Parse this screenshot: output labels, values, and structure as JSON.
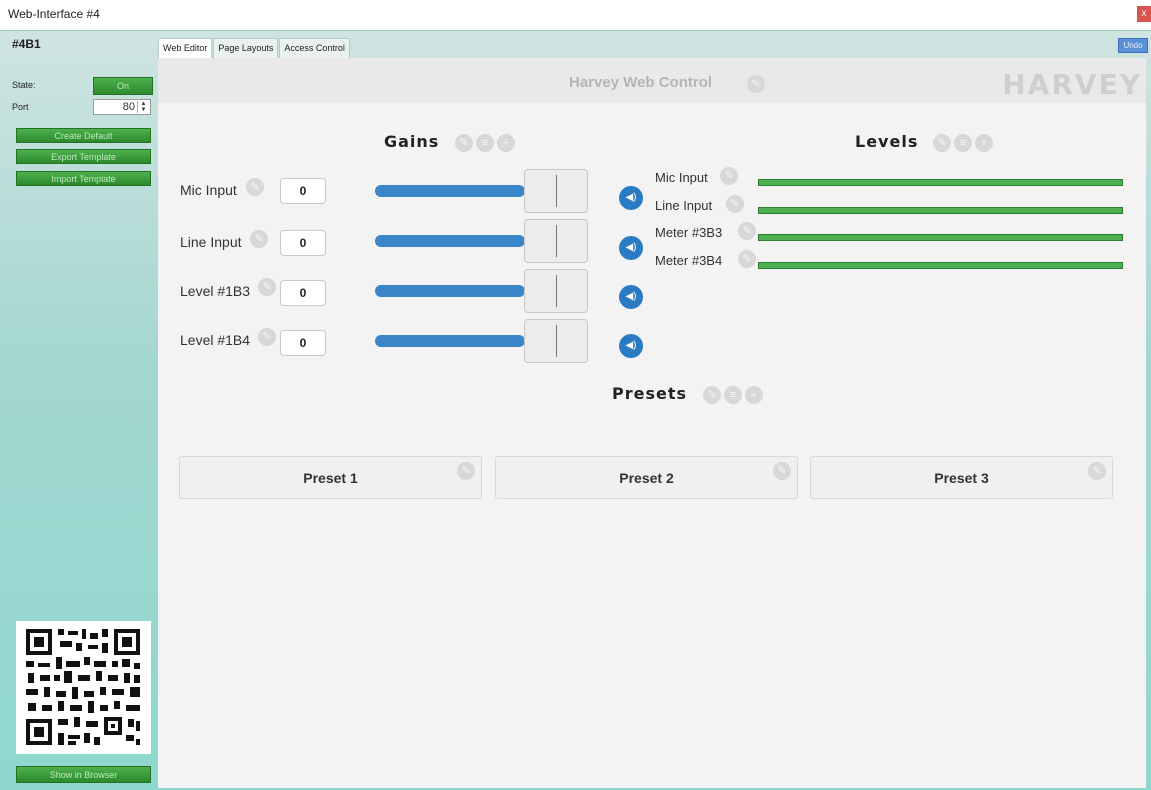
{
  "window": {
    "title": "Web-Interface #4",
    "close_label": "x"
  },
  "sidebar": {
    "node_id": "#4B1",
    "state_label": "State:",
    "state_value": "On",
    "port_label": "Port",
    "port_value": "80",
    "buttons": [
      "Create Default",
      "Export Template",
      "Import Template"
    ],
    "show_browser": "Show in Browser"
  },
  "tabs": [
    "Web Editor",
    "Page Layouts",
    "Access Control"
  ],
  "undo_label": "Undo",
  "header": {
    "title": "Harvey Web Control",
    "brand": "HARVEY"
  },
  "gains": {
    "title": "Gains",
    "rows": [
      {
        "label": "Mic Input",
        "value": "0"
      },
      {
        "label": "Line Input",
        "value": "0"
      },
      {
        "label": "Level #1B3",
        "value": "0"
      },
      {
        "label": "Level #1B4",
        "value": "0"
      }
    ]
  },
  "levels": {
    "title": "Levels",
    "rows": [
      {
        "label": "Mic Input"
      },
      {
        "label": "Line Input"
      },
      {
        "label": "Meter #3B3"
      },
      {
        "label": "Meter #3B4"
      }
    ]
  },
  "presets": {
    "title": "Presets",
    "items": [
      "Preset 1",
      "Preset 2",
      "Preset 3"
    ]
  },
  "icons": {
    "edit": "pencil-icon",
    "list": "list-icon",
    "add": "plus-icon",
    "speaker": "speaker-icon",
    "qr": "qr-code-icon"
  },
  "colors": {
    "accent_green": "#3a9e3a",
    "slider_blue": "#3a86c9",
    "meter_green": "#4caf50",
    "frame_teal": "#8fd8cf"
  }
}
